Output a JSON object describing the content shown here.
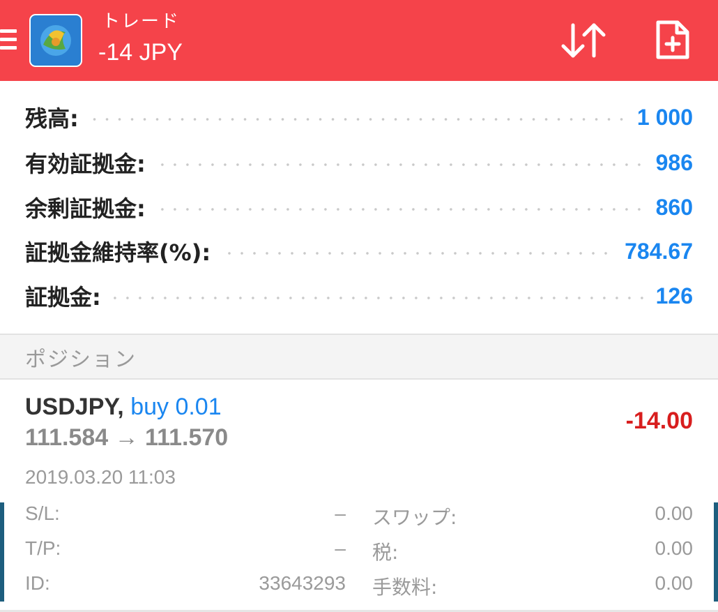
{
  "header": {
    "title": "トレード",
    "subtitle": "-14 JPY",
    "icons": {
      "menu": "menu-icon",
      "logo": "app-logo",
      "sort": "sort-icon",
      "new_order": "new-order-icon"
    }
  },
  "summary": {
    "rows": [
      {
        "label": "残高:",
        "value": "1 000"
      },
      {
        "label": "有効証拠金:",
        "value": "986"
      },
      {
        "label": "余剰証拠金:",
        "value": "860"
      },
      {
        "label": "証拠金維持率(%):",
        "value": "784.67"
      },
      {
        "label": "証拠金:",
        "value": "126"
      }
    ]
  },
  "section": {
    "title": "ポジション"
  },
  "position": {
    "symbol": "USDJPY,",
    "side": "buy 0.01",
    "prices": "111.584 → 111.570",
    "profit": "-14.00",
    "time": "2019.03.20 11:03",
    "details": {
      "sl_label": "S/L:",
      "sl_value": "–",
      "tp_label": "T/P:",
      "tp_value": "–",
      "id_label": "ID:",
      "id_value": "33643293",
      "swap_label": "スワップ:",
      "swap_value": "0.00",
      "tax_label": "税:",
      "tax_value": "0.00",
      "fee_label": "手数料:",
      "fee_value": "0.00"
    }
  },
  "colors": {
    "accent": "#f5434a",
    "blue": "#1a86f0",
    "red": "#d81e1e"
  }
}
